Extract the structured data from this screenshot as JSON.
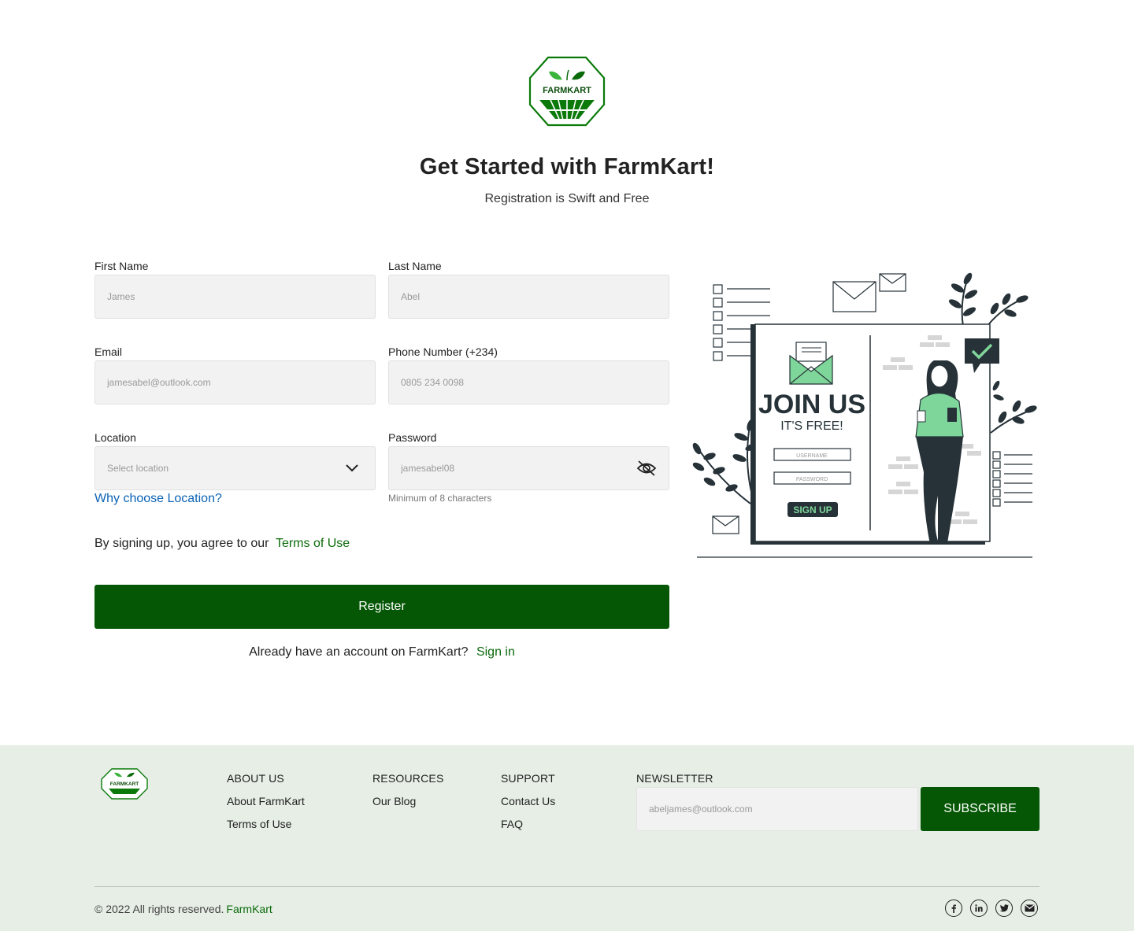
{
  "brand": {
    "name": "FARMKART",
    "accent": "#055705",
    "accent_light": "#38b53a"
  },
  "hero": {
    "title": "Get Started with FarmKart!",
    "subtitle": "Registration is Swift and Free"
  },
  "form": {
    "first_name": {
      "label": "First Name",
      "placeholder": "James"
    },
    "last_name": {
      "label": "Last Name",
      "placeholder": "Abel"
    },
    "email": {
      "label": "Email",
      "placeholder": "jamesabel@outlook.com"
    },
    "phone": {
      "label": "Phone Number (+234)",
      "placeholder": "0805 234 0098"
    },
    "location": {
      "label": "Location",
      "placeholder": "Select location",
      "help_link": "Why choose Location?"
    },
    "password": {
      "label": "Password",
      "placeholder": "jamesabel08",
      "hint": "Minimum of 8 characters"
    },
    "terms_prefix": "By signing up, you agree to our",
    "terms_link": "Terms of Use",
    "register_label": "Register",
    "signin_prefix": "Already have an account on FarmKart?",
    "signin_link": "Sign in"
  },
  "illustration": {
    "headline": "JOIN US",
    "subline": "IT'S FREE!",
    "username": "USERNAME",
    "password": "PASSWORD",
    "button": "SIGN UP"
  },
  "footer": {
    "logo_text": "FARMKART",
    "about": {
      "title": "ABOUT US",
      "links": [
        "About FarmKart",
        "Terms of Use"
      ]
    },
    "resources": {
      "title": "RESOURCES",
      "links": [
        "Our Blog"
      ]
    },
    "support": {
      "title": "SUPPORT",
      "links": [
        "Contact Us",
        "FAQ"
      ]
    },
    "newsletter": {
      "title": "NEWSLETTER",
      "placeholder": "abeljames@outlook.com",
      "button": "SUBSCRIBE"
    },
    "copyright": "© 2022 All rights reserved.",
    "copyright_brand": "FarmKart",
    "socials": [
      "facebook-icon",
      "linkedin-icon",
      "twitter-icon",
      "mail-icon"
    ]
  }
}
